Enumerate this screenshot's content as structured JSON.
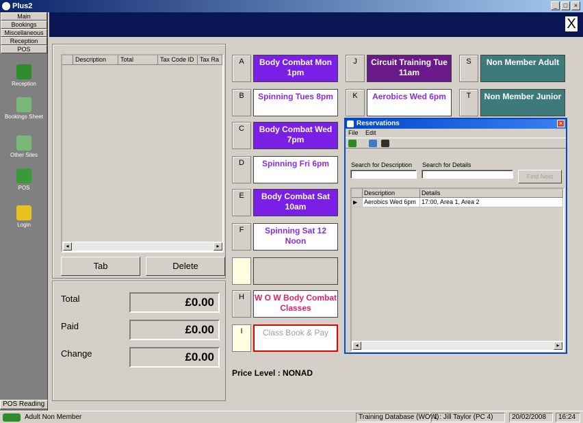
{
  "window": {
    "title": "Plus2"
  },
  "nav": {
    "buttons": [
      "Main",
      "Bookings",
      "Miscellaneous",
      "Reception",
      "POS"
    ]
  },
  "side": {
    "items": [
      {
        "label": "Reception",
        "icon": "reception-icon"
      },
      {
        "label": "Bookings Sheet",
        "icon": "bookings-sheet-icon"
      },
      {
        "label": "Other Sites",
        "icon": "other-sites-icon"
      },
      {
        "label": "POS",
        "icon": "pos-till-icon"
      },
      {
        "label": "Login",
        "icon": "login-keys-icon"
      }
    ],
    "pos_reading": "POS Reading"
  },
  "close_glyph": "X",
  "basket": {
    "columns": [
      "Description",
      "Total",
      "Tax Code ID",
      "Tax Ra"
    ],
    "tab_label": "Tab",
    "delete_label": "Delete"
  },
  "totals": {
    "total_label": "Total",
    "total_value": "£0.00",
    "paid_label": "Paid",
    "paid_value": "£0.00",
    "change_label": "Change",
    "change_value": "£0.00"
  },
  "price_level": "Price Level : NONAD",
  "keys": {
    "A": "A",
    "B": "B",
    "C": "C",
    "D": "D",
    "E": "E",
    "F": "F",
    "H": "H",
    "I": "I",
    "J": "J",
    "K": "K",
    "S": "S",
    "T": "T"
  },
  "products": {
    "A": "Body Combat Mon 1pm",
    "B": "Spinning Tues 8pm",
    "C": "Body Combat Wed 7pm",
    "D": "Spinning Fri 6pm",
    "E": "Body Combat Sat 10am",
    "F": "Spinning Sat 12 Noon",
    "H": "W O W Body Combat Classes",
    "I": "Class Book & Pay",
    "J": "Circuit Training Tue 11am",
    "K": "Aerobics Wed 6pm",
    "S": "Non Member Adult",
    "T": "Non Member Junior"
  },
  "reservations": {
    "title": "Reservations",
    "menu": [
      "File",
      "Edit"
    ],
    "search_desc_label": "Search for Description",
    "search_details_label": "Search for Details",
    "search_desc_value": "",
    "search_details_value": "",
    "find_next": "Find Next",
    "columns": [
      "Description",
      "Details"
    ],
    "rows": [
      {
        "description": "Aerobics Wed 6pm",
        "details": "17:00, Area 1, Area 2"
      }
    ]
  },
  "status": {
    "member_type": "Adult Non Member",
    "database": "Training Database (WOW)",
    "user": "1 : Jill Taylor (PC 4)",
    "date": "20/02/2008",
    "time": "16:24"
  },
  "colors": {
    "purple": "#7b1fe6",
    "dark_purple": "#6a1a8a",
    "teal": "#3d7a7a",
    "pink_text": "#e0206a",
    "navy_band": "#0a1654",
    "dialog_blue": "#0047cc"
  }
}
